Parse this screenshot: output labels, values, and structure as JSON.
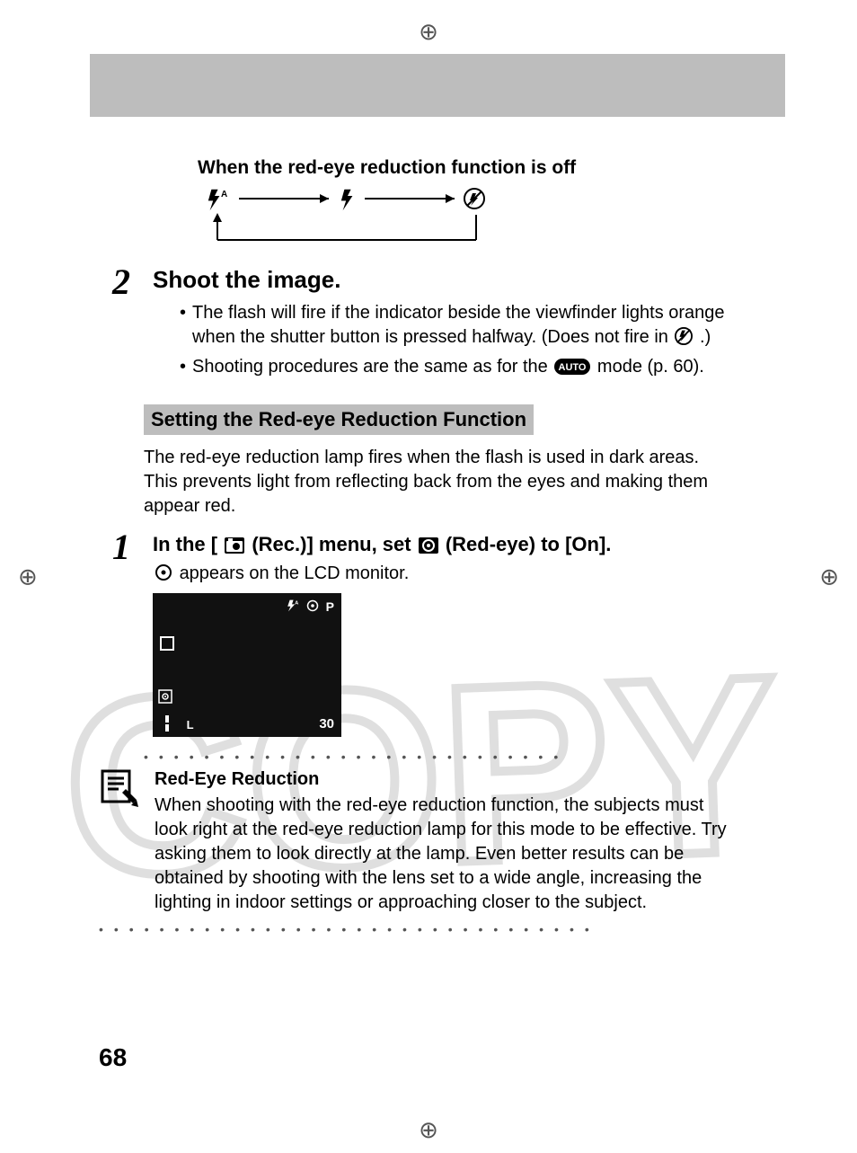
{
  "page_number": "68",
  "crop_marks": {
    "glyph": "⊕"
  },
  "off_heading": "When the red-eye reduction function is off",
  "cycle": {
    "icon_left": "flash-auto",
    "icon_mid": "flash-on",
    "icon_right": "flash-off"
  },
  "step2": {
    "num": "2",
    "heading": "Shoot the image.",
    "bullets": [
      {
        "pre": "The flash will fire if the indicator beside the viewfinder lights orange when the shutter button is pressed halfway. (Does not fire in ",
        "icon": "flash-off",
        "post": " .)"
      },
      {
        "pre": "Shooting procedures are the same as for the ",
        "icon": "auto-badge",
        "badge_text": "AUTO",
        "post": " mode (p. 60)."
      }
    ]
  },
  "subsection_heading": "Setting the Red-eye Reduction Function",
  "intro_para": "The red-eye reduction lamp fires when the flash is used in dark areas. This prevents light from reflecting back from the eyes and making them appear red.",
  "step1": {
    "num": "1",
    "line_pre": "In the [ ",
    "icon1": "camera-rec",
    "line_mid1": " (Rec.)] menu, set ",
    "icon2": "red-eye-boxed",
    "line_mid2": " (Red-eye) to [On].",
    "appears_pre": "",
    "appears_icon": "red-eye-circle",
    "appears_post": " appears on the LCD monitor.",
    "lcd": {
      "top_flash": "flash-auto",
      "top_eye": "red-eye-circle",
      "top_mode": "P",
      "bottom_left": "L",
      "bottom_right": "30"
    }
  },
  "note": {
    "title": "Red-Eye Reduction",
    "text": "When shooting with the red-eye reduction function, the subjects must look right at the red-eye reduction lamp for this mode to be effective. Try asking them to look directly at the lamp. Even better results can be obtained by shooting with the lens set to a wide angle, increasing the lighting in indoor settings or approaching closer to the subject."
  },
  "watermark_text": "COPY"
}
